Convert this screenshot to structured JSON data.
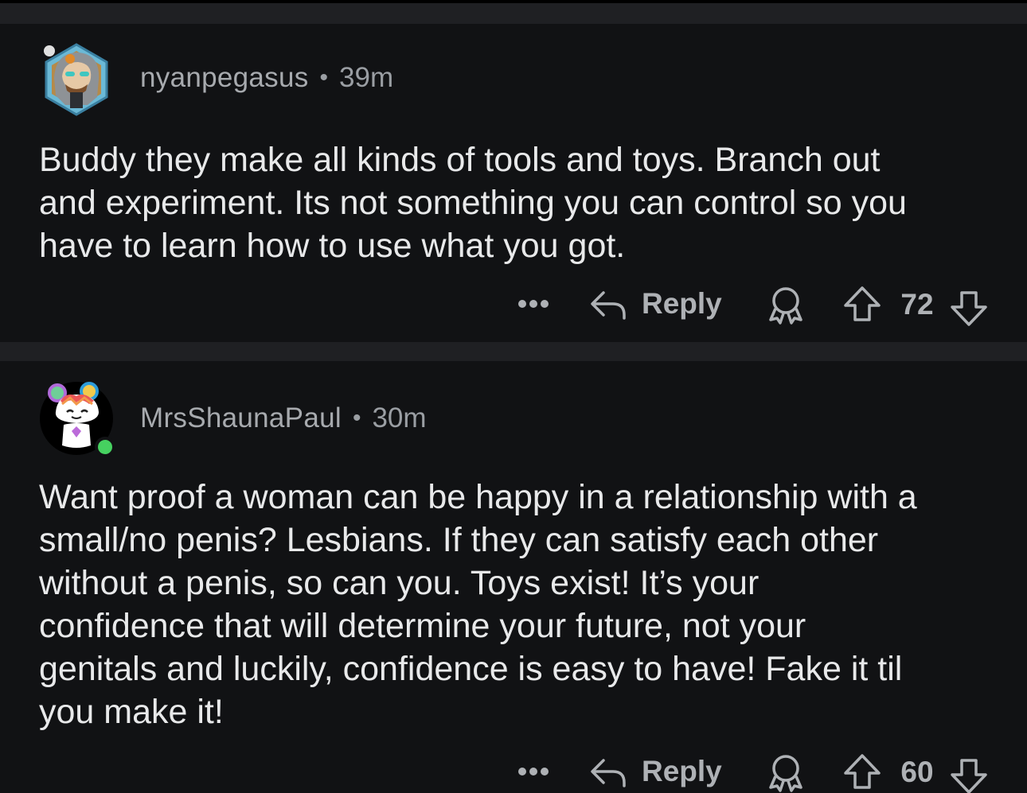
{
  "colors": {
    "background": "#1f2023",
    "card": "#111214",
    "text": "#e8e9ea",
    "meta": "#9a9ea3",
    "online": "#46d160"
  },
  "comments": [
    {
      "username": "nyanpegasus",
      "separator": "•",
      "time": "39m",
      "avatar_icon": "snoo-avatar-hooded-icon",
      "body_lines": [
        "Buddy they make all kinds of tools and toys.  Branch out",
        "and experiment. Its not something you can control so you",
        "have to learn how to use what you got."
      ],
      "more_icon": "ellipsis-icon",
      "reply_label": "Reply",
      "score": "72"
    },
    {
      "username": "MrsShaunaPaul",
      "separator": "•",
      "time": "30m",
      "avatar_icon": "snoo-avatar-rainbow-icon",
      "online": true,
      "body_lines": [
        "Want proof a woman can be happy in a relationship with a",
        "small/no penis? Lesbians. If they can satisfy each other",
        "without a penis, so can you. Toys exist! It’s your",
        "confidence that will determine your future, not your",
        "genitals and luckily, confidence is easy to have! Fake it til",
        "you make it!"
      ],
      "more_icon": "ellipsis-icon",
      "reply_label": "Reply",
      "score": "60"
    }
  ]
}
